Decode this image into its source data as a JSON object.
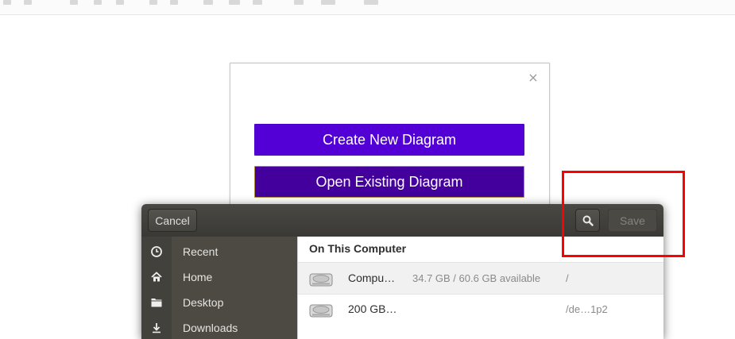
{
  "diagram_dialog": {
    "close_label": "×",
    "create_label": "Create New Diagram",
    "open_label": "Open Existing Diagram"
  },
  "file_chooser": {
    "cancel_label": "Cancel",
    "save_label": "Save",
    "search_icon": "search-icon",
    "sidebar": {
      "items": [
        {
          "label": "Recent",
          "icon": "clock-icon"
        },
        {
          "label": "Home",
          "icon": "home-icon"
        },
        {
          "label": "Desktop",
          "icon": "folder-icon"
        },
        {
          "label": "Downloads",
          "icon": "download-icon"
        }
      ]
    },
    "section_title": "On This Computer",
    "rows": [
      {
        "name": "Compu…",
        "size": "34.7 GB / 60.6 GB available",
        "path": "/"
      },
      {
        "name": "200 GB…",
        "size": "",
        "path": "/de…1p2"
      }
    ]
  },
  "colors": {
    "create_button": "#5200d6",
    "open_button": "#43009c",
    "header_bar": "#3f3e3a",
    "sidebar": "#4c4a43",
    "highlight": "#ff0000"
  }
}
